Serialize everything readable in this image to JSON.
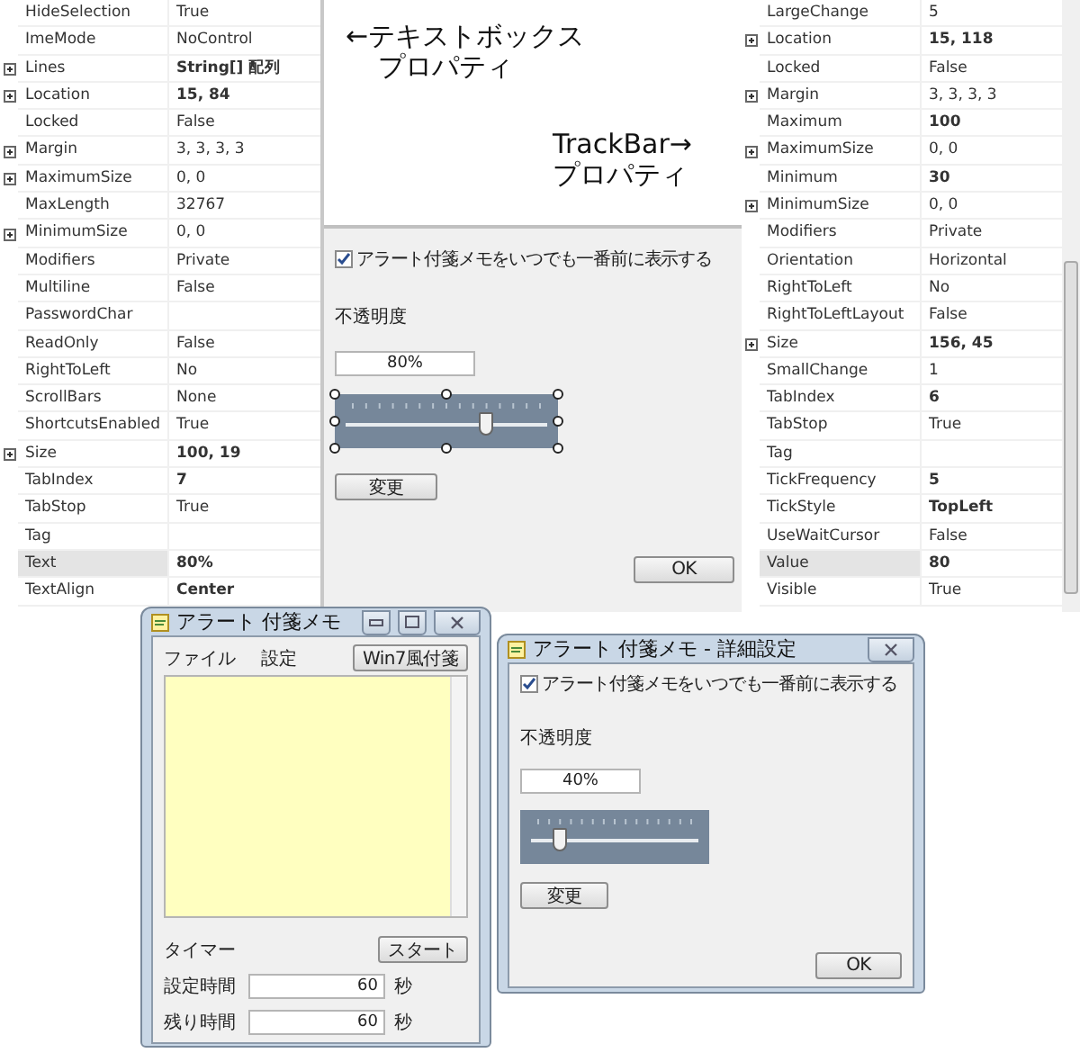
{
  "textbox_properties": {
    "rows": [
      {
        "name": "HideSelection",
        "value": "True",
        "bold": false,
        "expandable": false,
        "selected": false
      },
      {
        "name": "ImeMode",
        "value": "NoControl",
        "bold": false,
        "expandable": false,
        "selected": false
      },
      {
        "name": "Lines",
        "value": "String[] 配列",
        "bold": true,
        "expandable": true,
        "selected": false
      },
      {
        "name": "Location",
        "value": "15, 84",
        "bold": true,
        "expandable": true,
        "selected": false
      },
      {
        "name": "Locked",
        "value": "False",
        "bold": false,
        "expandable": false,
        "selected": false
      },
      {
        "name": "Margin",
        "value": "3, 3, 3, 3",
        "bold": false,
        "expandable": true,
        "selected": false
      },
      {
        "name": "MaximumSize",
        "value": "0, 0",
        "bold": false,
        "expandable": true,
        "selected": false
      },
      {
        "name": "MaxLength",
        "value": "32767",
        "bold": false,
        "expandable": false,
        "selected": false
      },
      {
        "name": "MinimumSize",
        "value": "0, 0",
        "bold": false,
        "expandable": true,
        "selected": false
      },
      {
        "name": "Modifiers",
        "value": "Private",
        "bold": false,
        "expandable": false,
        "selected": false
      },
      {
        "name": "Multiline",
        "value": "False",
        "bold": false,
        "expandable": false,
        "selected": false
      },
      {
        "name": "PasswordChar",
        "expandable": false,
        "selected": false
      },
      {
        "name": "ReadOnly",
        "value": "False",
        "bold": false,
        "expandable": false,
        "selected": false
      },
      {
        "name": "RightToLeft",
        "value": "No",
        "bold": false,
        "expandable": false,
        "selected": false
      },
      {
        "name": "ScrollBars",
        "value": "None",
        "bold": false,
        "expandable": false,
        "selected": false
      },
      {
        "name": "ShortcutsEnabled",
        "value": "True",
        "bold": false,
        "expandable": false,
        "selected": false
      },
      {
        "name": "Size",
        "value": "100, 19",
        "bold": true,
        "expandable": true,
        "selected": false
      },
      {
        "name": "TabIndex",
        "value": "7",
        "bold": true,
        "expandable": false,
        "selected": false
      },
      {
        "name": "TabStop",
        "value": "True",
        "bold": false,
        "expandable": false,
        "selected": false
      },
      {
        "name": "Tag",
        "expandable": false,
        "selected": false
      },
      {
        "name": "Text",
        "value": "80%",
        "bold": true,
        "expandable": false,
        "selected": true
      },
      {
        "name": "TextAlign",
        "value": "Center",
        "bold": true,
        "expandable": false,
        "selected": false
      }
    ]
  },
  "annotations": [
    {
      "lines": [
        "←テキストボックス",
        "プロパティ"
      ]
    },
    {
      "lines": [
        "TrackBar→",
        "プロパティ"
      ]
    }
  ],
  "designer_form": {
    "checkbox": {
      "label": "アラート付箋メモをいつでも一番前に表示する",
      "checked": true
    },
    "opacity_label": "不透明度",
    "opacity_field": {
      "value": "80%"
    },
    "trackbar": {
      "level": 0.71,
      "selected": true
    },
    "change_button": "変更",
    "ok_button": "OK"
  },
  "trackbar_properties": {
    "rows": [
      {
        "name": "LargeChange",
        "value": "5",
        "bold": false,
        "expandable": false,
        "selected": false
      },
      {
        "name": "Location",
        "value": "15, 118",
        "bold": true,
        "expandable": true,
        "selected": false
      },
      {
        "name": "Locked",
        "value": "False",
        "bold": false,
        "expandable": false,
        "selected": false
      },
      {
        "name": "Margin",
        "value": "3, 3, 3, 3",
        "bold": false,
        "expandable": true,
        "selected": false
      },
      {
        "name": "Maximum",
        "value": "100",
        "bold": true,
        "expandable": false,
        "selected": false
      },
      {
        "name": "MaximumSize",
        "value": "0, 0",
        "bold": false,
        "expandable": true,
        "selected": false
      },
      {
        "name": "Minimum",
        "value": "30",
        "bold": true,
        "expandable": false,
        "selected": false
      },
      {
        "name": "MinimumSize",
        "value": "0, 0",
        "bold": false,
        "expandable": true,
        "selected": false
      },
      {
        "name": "Modifiers",
        "value": "Private",
        "bold": false,
        "expandable": false,
        "selected": false
      },
      {
        "name": "Orientation",
        "value": "Horizontal",
        "bold": false,
        "expandable": false,
        "selected": false
      },
      {
        "name": "RightToLeft",
        "value": "No",
        "bold": false,
        "expandable": false,
        "selected": false
      },
      {
        "name": "RightToLeftLayout",
        "value": "False",
        "bold": false,
        "expandable": false,
        "selected": false
      },
      {
        "name": "Size",
        "value": "156, 45",
        "bold": true,
        "expandable": true,
        "selected": false
      },
      {
        "name": "SmallChange",
        "value": "1",
        "bold": false,
        "expandable": false,
        "selected": false
      },
      {
        "name": "TabIndex",
        "value": "6",
        "bold": true,
        "expandable": false,
        "selected": false
      },
      {
        "name": "TabStop",
        "value": "True",
        "bold": false,
        "expandable": false,
        "selected": false
      },
      {
        "name": "Tag",
        "expandable": false,
        "selected": false
      },
      {
        "name": "TickFrequency",
        "value": "5",
        "bold": true,
        "expandable": false,
        "selected": false
      },
      {
        "name": "TickStyle",
        "value": "TopLeft",
        "bold": true,
        "expandable": false,
        "selected": false
      },
      {
        "name": "UseWaitCursor",
        "value": "False",
        "bold": false,
        "expandable": false,
        "selected": false
      },
      {
        "name": "Value",
        "value": "80",
        "bold": true,
        "expandable": false,
        "selected": true
      },
      {
        "name": "Visible",
        "value": "True",
        "bold": false,
        "expandable": false,
        "selected": false
      }
    ]
  },
  "memo_window": {
    "title": "アラート 付箋メモ",
    "menu": [
      {
        "label": "ファイル"
      },
      {
        "label": "設定"
      }
    ],
    "style_button": "Win7風付箋",
    "timer_label": "タイマー",
    "start_button": "スタート",
    "fields": [
      {
        "label": "設定時間",
        "value": "60",
        "unit": "秒"
      },
      {
        "label": "残り時間",
        "value": "60",
        "unit": "秒"
      }
    ]
  },
  "settings_window": {
    "title": "アラート 付箋メモ - 詳細設定",
    "checkbox": {
      "label": "アラート付箋メモをいつでも一番前に表示する",
      "checked": true
    },
    "opacity_label": "不透明度",
    "opacity_field": {
      "value": "40%"
    },
    "trackbar": {
      "level": 0.14,
      "selected": false
    },
    "change_button": "変更",
    "ok_button": "OK"
  }
}
